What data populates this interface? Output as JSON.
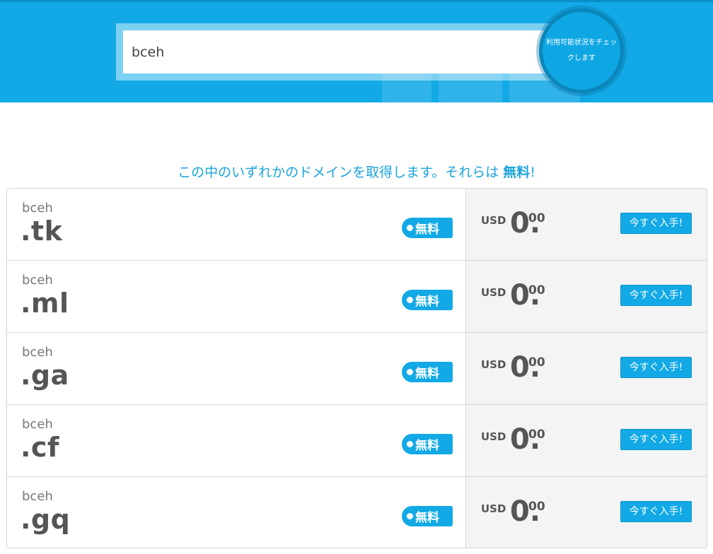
{
  "search": {
    "value": "bceh",
    "check_button_label": "利用可能状況をチェックします"
  },
  "headline": {
    "text": "この中のいずれかのドメインを取得します。それらは",
    "emphasis": "無料",
    "suffix": "!"
  },
  "colors": {
    "accent": "#12a9e6",
    "price_panel": "#f4f4f4",
    "text_dark": "#555555"
  },
  "domains": [
    {
      "name": "bceh",
      "tld": ".tk",
      "badge": "無料",
      "currency": "USD",
      "price_int": "0.",
      "price_dec": "00",
      "buy_label": "今すぐ入手!"
    },
    {
      "name": "bceh",
      "tld": ".ml",
      "badge": "無料",
      "currency": "USD",
      "price_int": "0.",
      "price_dec": "00",
      "buy_label": "今すぐ入手!"
    },
    {
      "name": "bceh",
      "tld": ".ga",
      "badge": "無料",
      "currency": "USD",
      "price_int": "0.",
      "price_dec": "00",
      "buy_label": "今すぐ入手!"
    },
    {
      "name": "bceh",
      "tld": ".cf",
      "badge": "無料",
      "currency": "USD",
      "price_int": "0.",
      "price_dec": "00",
      "buy_label": "今すぐ入手!"
    },
    {
      "name": "bceh",
      "tld": ".gq",
      "badge": "無料",
      "currency": "USD",
      "price_int": "0.",
      "price_dec": "00",
      "buy_label": "今すぐ入手!"
    }
  ]
}
